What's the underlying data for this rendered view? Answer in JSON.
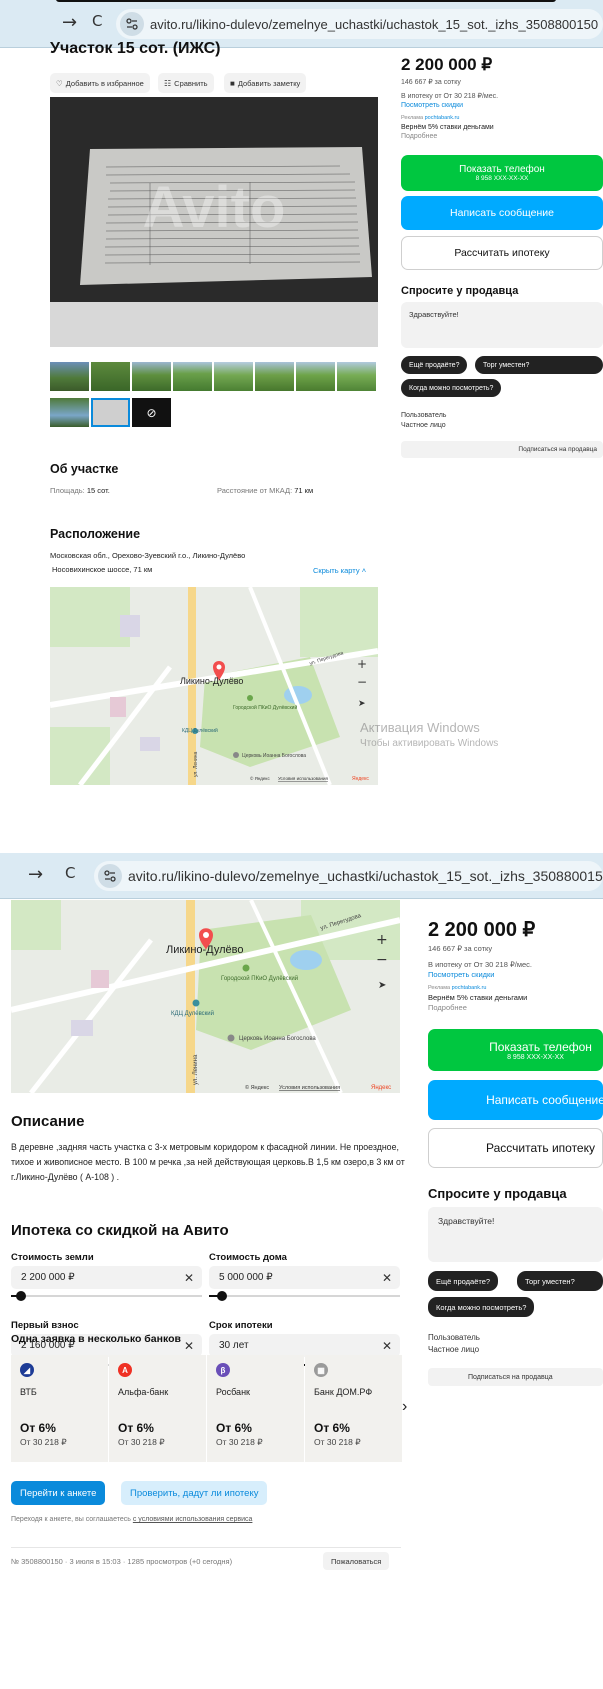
{
  "browser": {
    "back": "→",
    "reload": "C",
    "url": "avito.ru/likino-dulevo/zemelnye_uchastki/uchastok_15_sot._izhs_3508800150"
  },
  "listing": {
    "title": "Участок 15 сот. (ИЖС)",
    "actions": {
      "favorite": "Добавить в избранное",
      "compare": "Сравнить",
      "note": "Добавить заметку"
    },
    "photo_watermark": "Avito"
  },
  "sidebar": {
    "price": "2 200 000 ₽",
    "price_per_sotka": "146 667 ₽ за сотку",
    "mortgage_line": "В ипотеку от От 30 218 ₽/мес.",
    "see_discounts": "Посмотреть скидки",
    "ad_label": "Реклама",
    "ad_domain": "pochtabank.ru",
    "ad_text": "Вернём 5% ставки деньгами",
    "ad_more": "Подробнее",
    "show_phone": "Показать телефон",
    "phone_masked": "8 958 XXX-XX-XX",
    "write_message": "Написать сообщение",
    "calc_mortgage": "Рассчитать ипотеку",
    "ask_seller": "Спросите у продавца",
    "message_default": "Здравствуйте!",
    "quick_q1": "Ещё продаёте?",
    "quick_q2": "Торг уместен?",
    "quick_q3": "Когда можно посмотреть?",
    "seller_name": "Пользователь",
    "seller_type": "Частное лицо",
    "subscribe": "Подписаться на продавца"
  },
  "about": {
    "heading": "Об участке",
    "area_label": "Площадь:",
    "area_value": "15 сот.",
    "mkad_label": "Расстояние от МКАД:",
    "mkad_value": "71 км"
  },
  "location": {
    "heading": "Расположение",
    "address_line1": "Московская обл., Орехово-Зуевский г.о., Ликино-Дулёво",
    "address_line2": "Носовихинское шоссе, 71 км",
    "hide_map": "Скрыть карту",
    "map_city": "Ликино-Дулёво",
    "map_park": "Городской ПКиО Дулёвский",
    "map_kdc": "КДЦ Дулёвский",
    "map_church": "Церковь Иоанна Богослова",
    "map_street1": "ул. Перегудова",
    "map_street2": "ул. Ленина",
    "map_copy": "© Яндекс",
    "map_terms": "Условия использования",
    "map_brand": "Яндекс"
  },
  "watermark": {
    "line1": "Активация Windows",
    "line2": "Чтобы активировать Windows"
  },
  "description": {
    "heading": "Описание",
    "text": "В деревне ,задняя часть участка с 3-х метровым коридором к фасадной линии. Не проездное, тихое и живописное место. В 100 м речка ,за ней действующая церковь.В 1,5 км озеро,в 3 км от г.Ликино-Дулёво ( А-108 ) ."
  },
  "mortgage": {
    "heading": "Ипотека со скидкой на Авито",
    "land_cost_label": "Стоимость земли",
    "land_cost_value": "2 200 000 ₽",
    "house_cost_label": "Стоимость дома",
    "house_cost_value": "5 000 000 ₽",
    "down_payment_label": "Первый взнос",
    "down_payment_value": "2 160 000 ₽",
    "term_label": "Срок ипотеки",
    "term_value": "30 лет",
    "sliders": {
      "land": 0.05,
      "house": 0.07,
      "down": 0.45,
      "term": 1.0
    },
    "banks_heading": "Одна заявка в несколько банков",
    "banks": [
      {
        "name": "ВТБ",
        "rate": "От 6%",
        "monthly": "От 30 218 ₽",
        "color": "#1e3c96",
        "icon": "vtb-logo-icon"
      },
      {
        "name": "Альфа-банк",
        "rate": "От 6%",
        "monthly": "От 30 218 ₽",
        "color": "#ef3124",
        "icon": "alfa-logo-icon"
      },
      {
        "name": "Росбанк",
        "rate": "От 6%",
        "monthly": "От 30 218 ₽",
        "color": "#6a4fb8",
        "icon": "rosbank-logo-icon"
      },
      {
        "name": "Банк ДОМ.РФ",
        "rate": "От 6%",
        "monthly": "От 30 218 ₽",
        "color": "#9a9a9a",
        "icon": "domrf-logo-icon"
      }
    ],
    "next_arrow": "›",
    "go_to_form": "Перейти к анкете",
    "check_approval": "Проверить, дадут ли ипотеку",
    "agreement_prefix": "Переходя к анкете, вы соглашаетесь",
    "agreement_link": "с условиями использования сервиса"
  },
  "footer": {
    "meta": "№ 3508800150 · 3 июля в 15:03 · 1285 просмотров (+0 сегодня)",
    "report": "Пожаловаться"
  },
  "colors": {
    "green": "#00c740",
    "blue": "#00aaff",
    "link": "#0a8adb",
    "browser": "#dbeaf3"
  }
}
